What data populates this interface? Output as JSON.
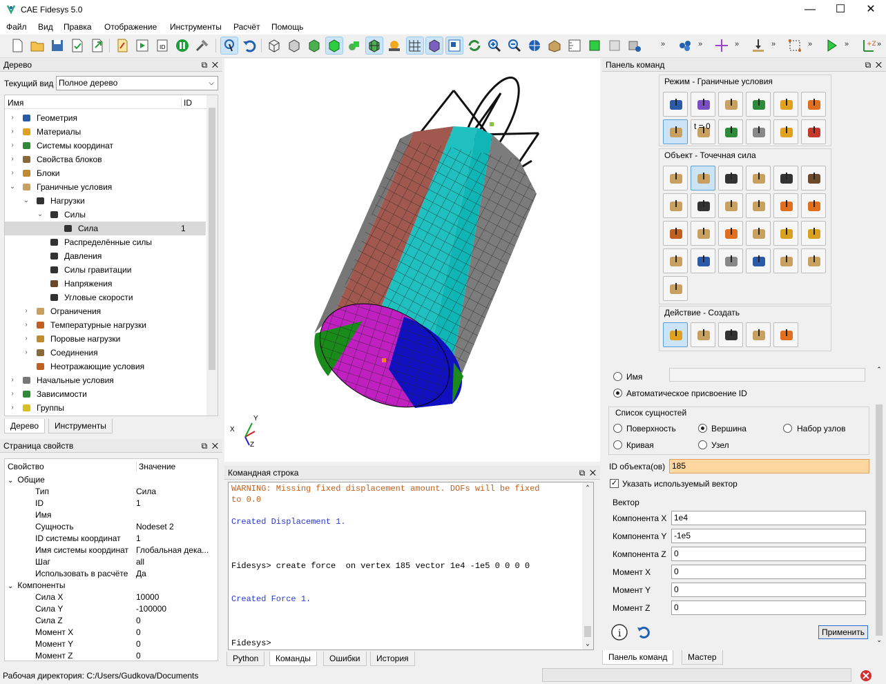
{
  "window": {
    "title": "CAE Fidesys 5.0",
    "minimize": "—",
    "maximize": "☐",
    "close": "✕"
  },
  "menu": [
    "Файл",
    "Вид",
    "Правка",
    "Отображение",
    "Инструменты",
    "Расчёт",
    "Помощь"
  ],
  "toolbar": {
    "overflow": "»"
  },
  "tree_panel": {
    "title": "Дерево",
    "current_view_label": "Текущий вид",
    "current_view_value": "Полное дерево",
    "col_name": "Имя",
    "col_id": "ID",
    "rows": [
      {
        "label": "Геометрия",
        "id": "",
        "icon": "geometry-icon"
      },
      {
        "label": "Материалы",
        "id": "",
        "icon": "materials-icon"
      },
      {
        "label": "Системы координат",
        "id": "",
        "icon": "coordinate-systems-icon"
      },
      {
        "label": "Свойства блоков",
        "id": "",
        "icon": "block-properties-icon"
      },
      {
        "label": "Блоки",
        "id": "",
        "icon": "blocks-icon"
      },
      {
        "label": "Граничные условия",
        "id": "",
        "icon": "boundary-conditions-icon"
      },
      {
        "label": "Нагрузки",
        "id": "",
        "icon": "loads-icon"
      },
      {
        "label": "Силы",
        "id": "",
        "icon": "forces-icon"
      },
      {
        "label": "Сила",
        "id": "1",
        "icon": "force-icon"
      },
      {
        "label": "Распределённые силы",
        "id": "",
        "icon": "distributed-forces-icon"
      },
      {
        "label": "Давления",
        "id": "",
        "icon": "pressures-icon"
      },
      {
        "label": "Силы гравитации",
        "id": "",
        "icon": "gravity-icon"
      },
      {
        "label": "Напряжения",
        "id": "",
        "icon": "stresses-icon"
      },
      {
        "label": "Угловые скорости",
        "id": "",
        "icon": "angular-velocity-icon"
      },
      {
        "label": "Ограничения",
        "id": "",
        "icon": "constraints-icon"
      },
      {
        "label": "Температурные нагрузки",
        "id": "",
        "icon": "temperature-icon"
      },
      {
        "label": "Поровые нагрузки",
        "id": "",
        "icon": "pore-loads-icon"
      },
      {
        "label": "Соединения",
        "id": "",
        "icon": "connections-icon"
      },
      {
        "label": "Неотражающие условия",
        "id": "",
        "icon": "non-reflecting-icon"
      },
      {
        "label": "Начальные условия",
        "id": "",
        "icon": "initial-conditions-icon"
      },
      {
        "label": "Зависимости",
        "id": "",
        "icon": "dependencies-icon"
      },
      {
        "label": "Группы",
        "id": "",
        "icon": "groups-icon"
      }
    ],
    "tabs": [
      "Дерево",
      "Инструменты"
    ]
  },
  "props_panel": {
    "title": "Страница свойств",
    "col_prop": "Свойство",
    "col_val": "Значение",
    "general": "Общие",
    "components": "Компоненты",
    "rows_general": [
      {
        "k": "Тип",
        "v": "Сила"
      },
      {
        "k": "ID",
        "v": "1"
      },
      {
        "k": "Имя",
        "v": ""
      },
      {
        "k": "Сущность",
        "v": "Nodeset 2"
      },
      {
        "k": "ID системы координат",
        "v": "1"
      },
      {
        "k": "Имя системы координат",
        "v": "Глобальная дека..."
      },
      {
        "k": "Шаг",
        "v": "all"
      },
      {
        "k": "Использовать в расчёте",
        "v": "Да"
      }
    ],
    "rows_components": [
      {
        "k": "Сила X",
        "v": "10000"
      },
      {
        "k": "Сила Y",
        "v": "-100000"
      },
      {
        "k": "Сила Z",
        "v": "0"
      },
      {
        "k": "Момент X",
        "v": "0"
      },
      {
        "k": "Момент Y",
        "v": "0"
      },
      {
        "k": "Момент Z",
        "v": "0"
      }
    ]
  },
  "viewport": {
    "axis_x": "X",
    "axis_y": "Y",
    "axis_z": "Z"
  },
  "command_panel": {
    "title": "Командная строка",
    "lines": [
      {
        "t": "WARNING: Missing fixed displacement amount. DOFs will be fixed",
        "c": "#c06020"
      },
      {
        "t": "to 0.0",
        "c": "#c06020"
      },
      {
        "t": "",
        "c": "#000"
      },
      {
        "t": "Created Displacement 1.",
        "c": "#2a3bd0"
      },
      {
        "t": "",
        "c": "#000"
      },
      {
        "t": "",
        "c": "#000"
      },
      {
        "t": "",
        "c": "#000"
      },
      {
        "t": "Fidesys> create force  on vertex 185 vector 1e4 -1e5 0 0 0 0",
        "c": "#000"
      },
      {
        "t": "",
        "c": "#000"
      },
      {
        "t": "",
        "c": "#000"
      },
      {
        "t": "Created Force 1.",
        "c": "#2a3bd0"
      },
      {
        "t": "",
        "c": "#000"
      },
      {
        "t": "",
        "c": "#000"
      },
      {
        "t": "",
        "c": "#000"
      },
      {
        "t": "Fidesys>",
        "c": "#000"
      }
    ],
    "tabs": [
      "Python",
      "Команды",
      "Ошибки",
      "История"
    ]
  },
  "right_panel": {
    "title": "Панель команд",
    "mode_label": "Режим - Граничные условия",
    "t0_label": "t = 0",
    "object_label": "Объект - Точечная сила",
    "action_label": "Действие - Создать",
    "name_radio": "Имя",
    "auto_id_radio": "Автоматическое присвоение ID",
    "entity_list_label": "Список сущностей",
    "entity_options": [
      "Поверхность",
      "Вершина",
      "Набор узлов",
      "Кривая",
      "Узел"
    ],
    "object_id_label": "ID объекта(ов)",
    "object_id_value": "185",
    "use_vector_label": "Указать используемый вектор",
    "vector_label": "Вектор",
    "vector_rows": [
      {
        "label": "Компонента X",
        "value": "1e4"
      },
      {
        "label": "Компонента Y",
        "value": "-1e5"
      },
      {
        "label": "Компонента Z",
        "value": "0"
      },
      {
        "label": "Момент X",
        "value": "0"
      },
      {
        "label": "Момент Y",
        "value": "0"
      },
      {
        "label": "Момент Z",
        "value": "0"
      }
    ],
    "apply_label": "Применить",
    "tabs": [
      "Панель команд",
      "Мастер"
    ]
  },
  "status": {
    "workdir": "Рабочая директория: C:/Users/Gudkova/Documents"
  }
}
